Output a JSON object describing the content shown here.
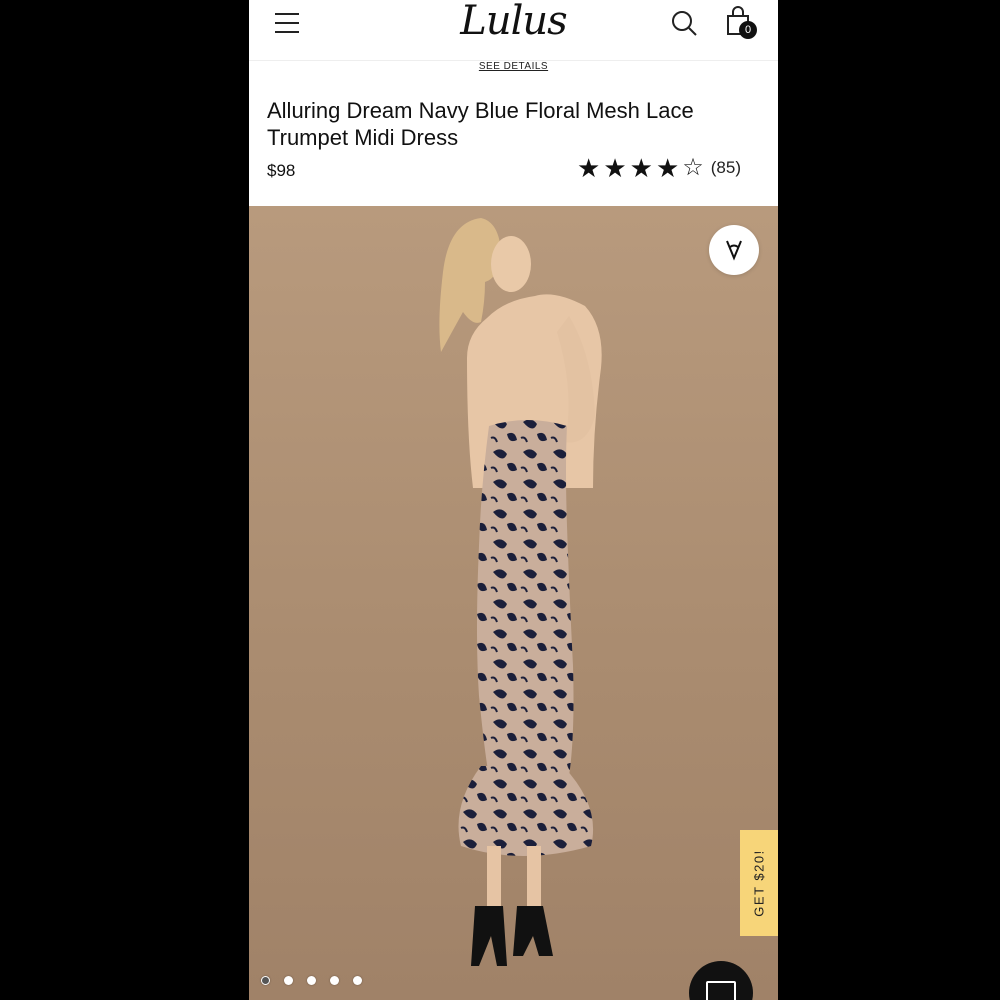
{
  "header": {
    "logo": "Lulus",
    "bag_count": "0"
  },
  "promo": {
    "see_details": "SEE DETAILS"
  },
  "product": {
    "title": "Alluring Dream Navy Blue Floral Mesh Lace Trumpet Midi Dress",
    "price": "$98",
    "rating": 4,
    "rating_max": 5,
    "review_count": "(85)",
    "image_count": 5,
    "active_image": 1
  },
  "side_tab": {
    "label": "GET $20!"
  },
  "colors": {
    "accent_tab": "#f7d579",
    "image_background": "#b0917a"
  },
  "icons": [
    "menu-icon",
    "search-icon",
    "shopping-bag-icon",
    "heart-icon",
    "chat-icon"
  ]
}
